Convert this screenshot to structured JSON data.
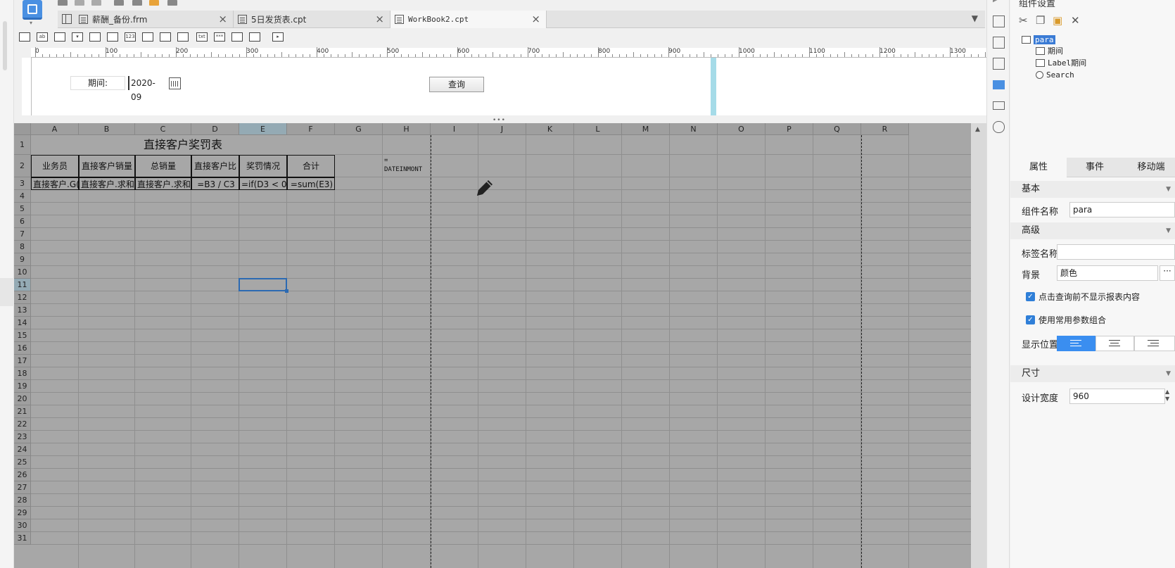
{
  "tabs": [
    {
      "label": "薪酬_备份.frm"
    },
    {
      "label": "5日发货表.cpt"
    },
    {
      "label": "WorkBook2.cpt"
    }
  ],
  "param": {
    "label": "期间:",
    "value": "2020-09",
    "query_button": "查询"
  },
  "ruler": [
    "0",
    "100",
    "200",
    "300",
    "400",
    "500",
    "600",
    "700",
    "800",
    "900",
    "1000",
    "1100",
    "1200",
    "1300"
  ],
  "sheet": {
    "columns": [
      "A",
      "B",
      "C",
      "D",
      "E",
      "F",
      "G",
      "H",
      "I",
      "J",
      "K",
      "L",
      "M",
      "N",
      "O",
      "P",
      "Q",
      "R"
    ],
    "rows": [
      "1",
      "2",
      "3",
      "4",
      "5",
      "6",
      "7",
      "8",
      "9",
      "10",
      "11",
      "12",
      "13",
      "14",
      "15",
      "16",
      "17",
      "18",
      "19",
      "20",
      "21",
      "22",
      "23",
      "24",
      "25",
      "26",
      "27",
      "28",
      "29",
      "30",
      "31"
    ],
    "title": "直接客户奖罚表",
    "headers": [
      "业务员",
      "直接客户销量",
      "总销量",
      "直接客户比",
      "奖罚情况",
      "合计"
    ],
    "row3": [
      "直接客户.G(",
      "直接客户.求和(",
      "直接客户.求和(",
      "=B3 / C3",
      "=if(D3 < 0.",
      "=sum(E3)"
    ],
    "h2_line1": "=",
    "h2_line2": "DATEINMONT"
  },
  "panel": {
    "title": "组件设置",
    "tree": [
      {
        "label": "para",
        "selected": true
      },
      {
        "label": "期间"
      },
      {
        "label": "Label期间"
      },
      {
        "label": "Search"
      }
    ],
    "tabs": [
      "属性",
      "事件",
      "移动端"
    ],
    "sections": {
      "basic": "基本",
      "advanced": "高级",
      "size": "尺寸"
    },
    "fields": {
      "name_label": "组件名称",
      "name_value": "para",
      "tag_label": "标签名称",
      "tag_value": "",
      "bg_label": "背景",
      "bg_value": "颜色",
      "check1": "点击查询前不显示报表内容",
      "check2": "使用常用参数组合",
      "position_label": "显示位置",
      "width_label": "设计宽度",
      "width_value": "960"
    }
  },
  "icons": {
    "app": "report-designer-icon",
    "pencil": "pencil-icon",
    "calendar": "calendar-icon"
  },
  "colors": {
    "accent": "#4a90e2",
    "selection": "#2c6ab2",
    "sheet_bg": "#a7a7a7",
    "para_boundary": "#a5dbe8"
  }
}
